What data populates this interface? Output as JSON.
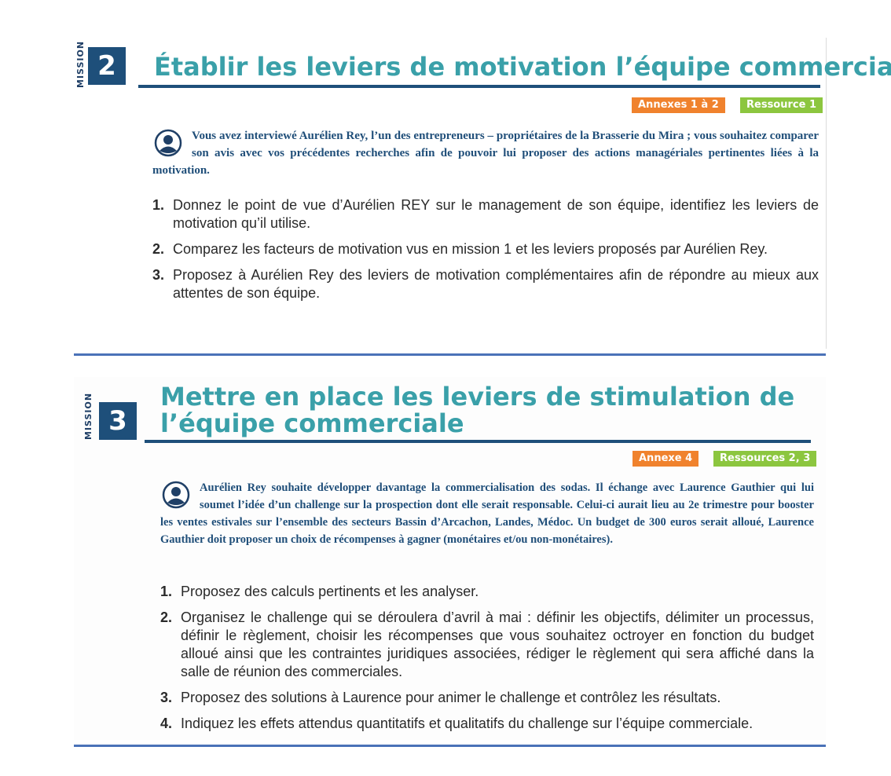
{
  "mission2": {
    "label": "MISSION",
    "number": "2",
    "title": "Établir les leviers de motivation l’équipe commerciale",
    "tags": [
      "Annexes 1 à 2",
      "Ressource 1"
    ],
    "intro": "Vous avez interviewé Aurélien Rey, l’un des entrepreneurs – propriétaires de la Brasserie du Mira ; vous souhaitez comparer son avis avec vos précédentes recherches afin de pouvoir lui proposer des actions managériales pertinentes liées à la motivation.",
    "questions": [
      {
        "n": "1.",
        "text": "Donnez le point de vue d’Aurélien REY sur le management de son équipe, identifiez les leviers de motivation qu’il utilise."
      },
      {
        "n": "2.",
        "text": "Comparez les facteurs de motivation vus en mission 1 et les leviers proposés par Aurélien Rey."
      },
      {
        "n": "3.",
        "text": "Proposez à Aurélien Rey des leviers de motivation complémentaires afin de répondre au mieux aux attentes de son équipe."
      }
    ]
  },
  "mission3": {
    "label": "MISSION",
    "number": "3",
    "title": "Mettre en place les leviers de stimulation de l’équipe commerciale",
    "tags": [
      "Annexe 4",
      "Ressources 2, 3"
    ],
    "intro": "Aurélien Rey souhaite développer davantage la commercialisation des sodas. Il échange avec Laurence Gauthier qui lui soumet l’idée d’un challenge sur la prospection dont elle serait responsable. Celui-ci aurait lieu au 2e trimestre pour booster les ventes estivales sur l’ensemble des secteurs Bassin d’Arcachon, Landes, Médoc. Un budget de 300 euros serait alloué, Laurence Gauthier doit proposer un choix de récompenses à gagner (monétaires et/ou non-monétaires).",
    "questions": [
      {
        "n": "1.",
        "text": "Proposez des calculs pertinents et les analyser."
      },
      {
        "n": "2.",
        "text": "Organisez le challenge qui se déroulera d’avril à mai : définir les objectifs, délimiter un processus, définir le règlement, choisir les récompenses que vous souhaitez octroyer en fonction du budget alloué ainsi que les contraintes juridiques associées, rédiger le règlement qui sera affiché dans la salle de réunion des commerciales."
      },
      {
        "n": "3.",
        "text": "Proposez des solutions à Laurence pour animer le challenge et contrôlez les résultats."
      },
      {
        "n": "4.",
        "text": "Indiquez les effets attendus quantitatifs et qualitatifs du challenge sur l’équipe commerciale."
      }
    ]
  },
  "colors": {
    "title_teal": "#3aa0a9",
    "navy": "#1e4f7a",
    "tag_orange": "#f0822d",
    "tag_green": "#8cc63f",
    "separator_blue": "#4a72b8"
  },
  "icons": [
    "user-avatar-icon",
    "user-avatar-icon"
  ]
}
